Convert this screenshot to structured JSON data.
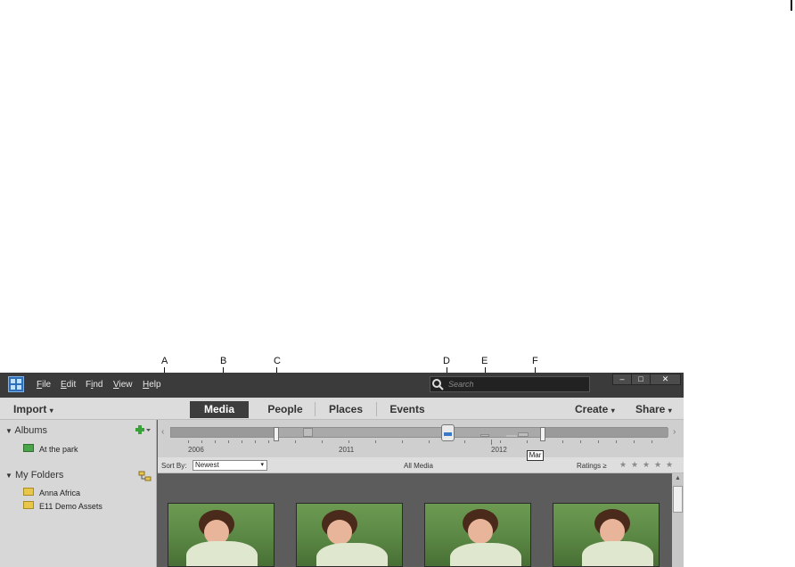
{
  "callouts": [
    "A",
    "B",
    "C",
    "D",
    "E",
    "F"
  ],
  "menu": {
    "items": [
      {
        "label": "File",
        "u": "F",
        "rest": "ile"
      },
      {
        "label": "Edit",
        "u": "E",
        "rest": "dit"
      },
      {
        "label": "Find",
        "pre": "F",
        "u": "i",
        "rest": "nd"
      },
      {
        "label": "View",
        "u": "V",
        "rest": "iew"
      },
      {
        "label": "Help",
        "u": "H",
        "rest": "elp"
      }
    ],
    "search_placeholder": "Search",
    "window_buttons": [
      "–",
      "□",
      "✕"
    ]
  },
  "tabbar": {
    "import_label": "Import",
    "tabs": [
      "Media",
      "People",
      "Places",
      "Events"
    ],
    "active_tab": "Media",
    "create_label": "Create",
    "share_label": "Share",
    "dropdown_glyph": "▾"
  },
  "sidebar": {
    "albums_heading": "Albums",
    "albums": [
      "At the park"
    ],
    "folders_heading": "My Folders",
    "folders": [
      "Anna Africa",
      "E11 Demo Assets"
    ]
  },
  "timeline": {
    "years": [
      "2006",
      "2011",
      "2012"
    ],
    "tooltip": "Mar"
  },
  "sortbar": {
    "sort_label": "Sort By:",
    "sort_value": "Newest",
    "view_label": "All Media",
    "ratings_label": "Ratings",
    "ratings_operator": "≥",
    "stars_total": 5
  },
  "grid": {
    "thumbnail_count": 4
  },
  "colors": {
    "window_dark": "#3b3b3b",
    "active_tab": "#3d3d3d",
    "panel": "#d7d7d7"
  }
}
